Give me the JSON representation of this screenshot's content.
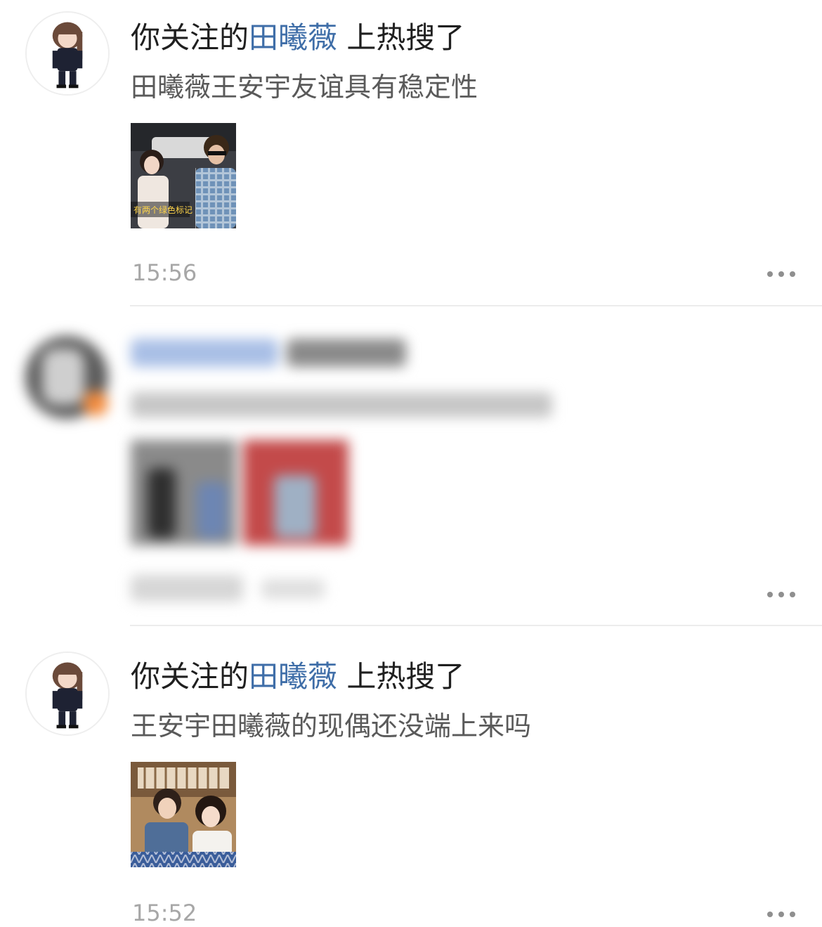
{
  "items": [
    {
      "prefix": "你关注的",
      "name": "田曦薇",
      "suffix": " 上热搜了",
      "text": "田曦薇王安宇友谊具有稳定性",
      "image_alt": "car-selfie-photo",
      "image_caption": "有两个绿色标记",
      "time": "15:56"
    },
    {
      "prefix": "你关注的",
      "name": "田曦薇",
      "suffix": " 上热搜了",
      "text": "王安宇田曦薇的现偶还没端上来吗",
      "image_alt": "couple-photo",
      "time": "15:52"
    }
  ],
  "colors": {
    "name_link": "#3f6ea8",
    "title": "#1f1f1f",
    "body": "#5a5a5a",
    "time": "#a7a7a7",
    "divider": "#ececec"
  },
  "icons": {
    "more": "more-dots-icon",
    "avatar": "chibi-avatar"
  }
}
